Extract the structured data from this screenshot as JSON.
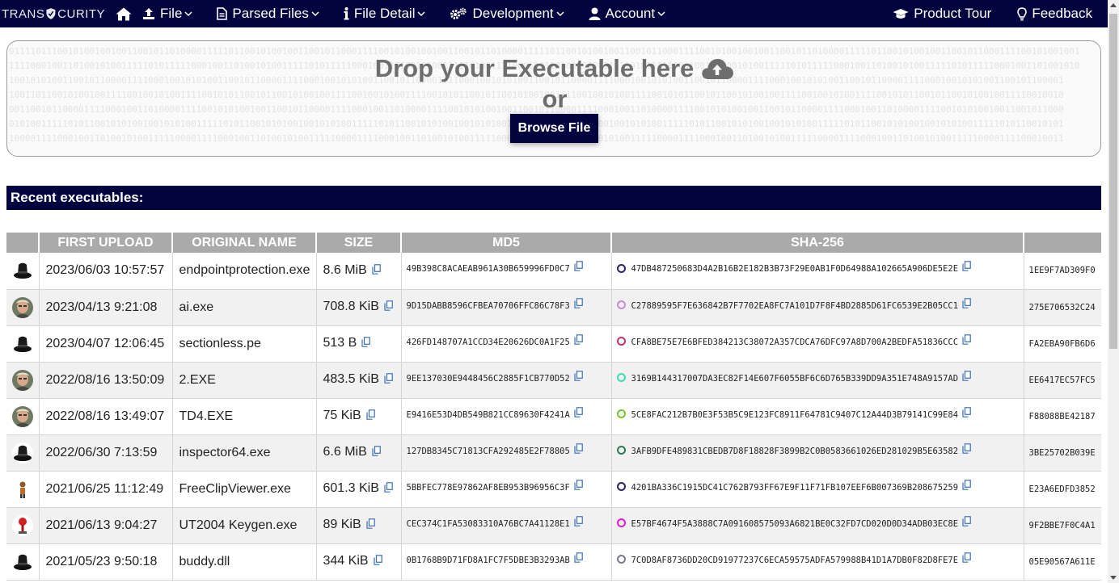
{
  "nav": {
    "logo_left": "TRANS",
    "logo_right": "CURITY",
    "items": [
      {
        "label": "File",
        "icon": "upload-icon"
      },
      {
        "label": "Parsed Files",
        "icon": "document-icon"
      },
      {
        "label": "File Detail",
        "icon": "info-icon"
      },
      {
        "label": "Development",
        "icon": "gears-icon"
      },
      {
        "label": "Account",
        "icon": "user-icon"
      }
    ],
    "right": [
      {
        "label": "Product Tour",
        "icon": "graduation-cap-icon"
      },
      {
        "label": "Feedback",
        "icon": "lightbulb-icon"
      }
    ]
  },
  "dropzone": {
    "title": "Drop your Executable here",
    "or": "or",
    "browse_label": "Browse File",
    "binary_lines": [
      "01111011100101001001001100101101000011111011001010010011001011000111100101001001001100101101000011111011001010010011001011000111100101001001001100101101000011111011001010010011001011000111100101001001",
      "11110001001101001010011111010111110001001101001010011111010111110001001101001010011111010111110001001101001010011111010111110001001101001010011111010111110001001101001010011111010111110001001101001010",
      "10010101001100101100001111000100101010011001011000011110001001010100110010110000111100010010101001100101100001111000100101010011001011000011110001001010100110010110000111100010010101001100101100001",
      "10011011001010010011110010010100111100101011001011001010010011110010010100111100101011001011001010010011110010010100111100101011001011001010010011110010010100111100101011001011001010010011110010010",
      "00110010110000111100010011010000111100101010010011001011000011110001001101000011110010101001001100101100001111000100110100001111001010100100110010110000111100010011010000111100101010010011001011000",
      "01010011111010110010101001001010100111110101100101010010010101001111101011001010100100101010011111010110010101001001010100111110101100101010010010101001111101011001010100100101010011111010110010101",
      "10000111100010011010010100111110000111100010011010010100111110000111100010011010010100111110000111100010011010010100111110000111100010011010010100111110000111100010011010010100111110000111100010011"
    ]
  },
  "recent": {
    "title": "Recent executables:",
    "columns": [
      "",
      "FIRST UPLOAD",
      "ORIGINAL NAME",
      "SIZE",
      "MD5",
      "SHA-256",
      ""
    ],
    "rows": [
      {
        "avatar": "hat",
        "upload": "2023/06/03 10:57:57",
        "name": "endpointprotection.exe",
        "size": "8.6 MiB",
        "md5": "49B398C8ACAEAB961A30B659996FD0C7",
        "sha_color": "#2d2466",
        "sha256": "47DB487250683D4A2B16B2E182B3B73F29E0AB1F0D64988A102665A906DE5E2E",
        "extra": "1EE9F7AD309F0"
      },
      {
        "avatar": "face",
        "upload": "2023/04/13 9:21:08",
        "name": "ai.exe",
        "size": "708.8 KiB",
        "md5": "9D15DABB8596CFBEA70706FFC86C78F3",
        "sha_color": "#c98bd6",
        "sha256": "C27889595F7E636842B7F7702EA8FC7A101D7F8F4BD2885D61FC6539E2B05CC1",
        "extra": "275E706532C24"
      },
      {
        "avatar": "hat",
        "upload": "2023/04/07 12:06:45",
        "name": "sectionless.pe",
        "size": "513 B",
        "md5": "426FD148707A1CCD34E20626DC0A1F25",
        "sha_color": "#c2336a",
        "sha256": "CFA8BE75E7E6BFED384213C38072A357CDCA76DFC97A8D700A2BEDFA51836CCC",
        "extra": "FA2EBA90FB6D6"
      },
      {
        "avatar": "face",
        "upload": "2022/08/16 13:50:09",
        "name": "2.EXE",
        "size": "483.5 KiB",
        "md5": "9EE137030E9448456C2885F1CB770D52",
        "sha_color": "#3fd9b4",
        "sha256": "3169B144317007DA3EC82F14E607F6055BF6C6D765B339DD9A351E748A9157AD",
        "extra": "EE6417EC57FC5"
      },
      {
        "avatar": "face",
        "upload": "2022/08/16 13:49:07",
        "name": "TD4.EXE",
        "size": "75 KiB",
        "md5": "E9416E53D4DB549B821CC89630F4241A",
        "sha_color": "#6fc52a",
        "sha256": "5CE8FAC212B7B0E3F53B5C9E123FC8911F64781C9407C12A44D3B79141C99E84",
        "extra": "F88088BE42187"
      },
      {
        "avatar": "hat",
        "upload": "2022/06/30 7:13:59",
        "name": "inspector64.exe",
        "size": "6.6 MiB",
        "md5": "127DB8345C71813CFA292485E2F78805",
        "sha_color": "#2f7a5a",
        "sha256": "3AFB9DFE489831CBEDB7D8F18828F3899B2C0B0583661026ED281029B5E63582",
        "extra": "3BE25702B039E"
      },
      {
        "avatar": "figure",
        "upload": "2021/06/25 11:12:49",
        "name": "FreeClipViewer.exe",
        "size": "601.3 KiB",
        "md5": "5BBFEC778E97862AF8EB953B96956C3F",
        "sha_color": "#2d2466",
        "sha256": "4201BA336C1915DC41C762B793FF67E9F11F71FB107EEF6B007369B208675259",
        "extra": "E23A6EDFD3852"
      },
      {
        "avatar": "red",
        "upload": "2021/06/13 9:04:27",
        "name": "UT2004 Keygen.exe",
        "size": "89 KiB",
        "md5": "CEC374C1FA53083310A76BC7A41128E1",
        "sha_color": "#e01ad8",
        "sha256": "E57BF4674F5A3888C7A091608575093A6821BE0C32FD7CD020D0D34ADB03EC8E",
        "extra": "9F2BBE7F0C4A1"
      },
      {
        "avatar": "hat",
        "upload": "2021/05/23 9:50:18",
        "name": "buddy.dll",
        "size": "344 KiB",
        "md5": "0B1768B9D71FD8A1FC7F5DBE3B3293AB",
        "sha_color": "#7a7a8c",
        "sha256": "7C0D8AF8736DD20CD91977237C6ECA59575ADFA579988B41D1A7DB0F82D8FE7E",
        "extra": "05E90567A611E"
      }
    ]
  },
  "colors": {
    "navy": "#02023f",
    "header_gray": "#aaaaaa"
  }
}
